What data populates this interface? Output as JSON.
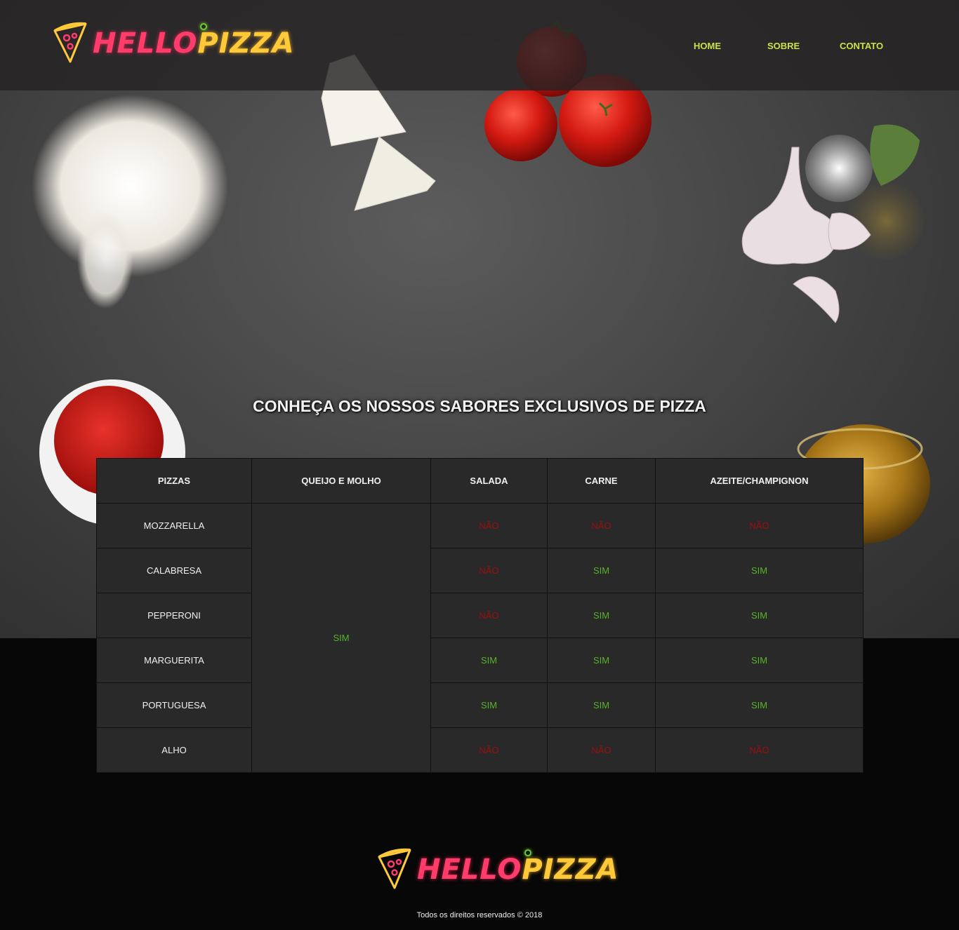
{
  "brand": {
    "hello": "HELLO",
    "pizza": "PIZZA",
    "colors": {
      "hello": "#ff3c6a",
      "pizza": "#ffc93a",
      "accent_dot": "#6bd12b"
    }
  },
  "nav": {
    "items": [
      {
        "label": "HOME"
      },
      {
        "label": "SOBRE"
      },
      {
        "label": "CONTATO"
      }
    ],
    "color": "#c8e34a"
  },
  "section": {
    "title": "CONHEÇA OS NOSSOS SABORES EXCLUSIVOS DE PIZZA"
  },
  "table": {
    "headers": [
      "PIZZAS",
      "QUEIJO E MOLHO",
      "SALADA",
      "CARNE",
      "AZEITE/CHAMPIGNON"
    ],
    "queijo_e_molho_all": "SIM",
    "rows": [
      {
        "name": "MOZZARELLA",
        "salada": "NÃO",
        "carne": "NÃO",
        "azeite": "NÃO"
      },
      {
        "name": "CALABRESA",
        "salada": "NÃO",
        "carne": "SIM",
        "azeite": "SIM"
      },
      {
        "name": "PEPPERONI",
        "salada": "NÃO",
        "carne": "SIM",
        "azeite": "SIM"
      },
      {
        "name": "MARGUERITA",
        "salada": "SIM",
        "carne": "SIM",
        "azeite": "SIM"
      },
      {
        "name": "PORTUGUESA",
        "salada": "SIM",
        "carne": "SIM",
        "azeite": "SIM"
      },
      {
        "name": "ALHO",
        "salada": "NÃO",
        "carne": "NÃO",
        "azeite": "NÃO"
      }
    ],
    "colors": {
      "sim": "#55b32c",
      "nao": "#9a0f0f"
    }
  },
  "footer": {
    "copyright": "Todos os direitos reservados © 2018"
  }
}
